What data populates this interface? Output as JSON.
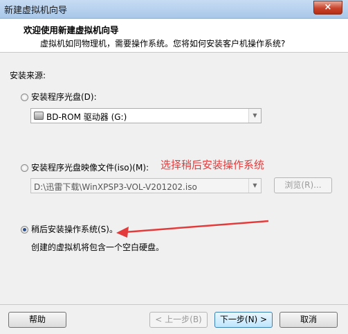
{
  "window": {
    "title": "新建虚拟机向导",
    "close_label": "×"
  },
  "header": {
    "title": "欢迎使用新建虚拟机向导",
    "subtitle": "虚拟机如同物理机，需要操作系统。您将如何安装客户机操作系统?"
  },
  "install_source": {
    "label": "安装来源:",
    "disc_option": {
      "label": "安装程序光盘(D):",
      "selected": false,
      "drive_value": "BD-ROM 驱动器 (G:)"
    },
    "iso_option": {
      "label": "安装程序光盘映像文件(iso)(M):",
      "selected": false,
      "path_value": "D:\\迅雷下载\\WinXPSP3-VOL-V201202.iso",
      "browse_label": "浏览(R)..."
    },
    "later_option": {
      "label": "稍后安装操作系统(S)。",
      "selected": true,
      "description": "创建的虚拟机将包含一个空白硬盘。"
    }
  },
  "annotation": {
    "text": "选择稍后安装操作系统",
    "color": "#e33b3b"
  },
  "footer": {
    "help_label": "帮助",
    "back_label": "< 上一步(B)",
    "next_label": "下一步(N) >",
    "cancel_label": "取消"
  }
}
